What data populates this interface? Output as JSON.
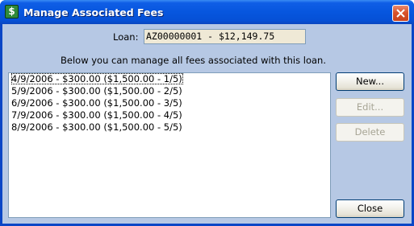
{
  "window": {
    "title": "Manage Associated Fees",
    "icon": "dollar-note-icon",
    "close_icon": "close-icon"
  },
  "loan": {
    "label": "Loan:",
    "value": "AZ00000001 - $12,149.75"
  },
  "instruction": "Below you can manage all fees associated with this loan.",
  "fees": [
    "4/9/2006 - $300.00 ($1,500.00 - 1/5)",
    "5/9/2006 - $300.00 ($1,500.00 - 2/5)",
    "6/9/2006 - $300.00 ($1,500.00 - 3/5)",
    "7/9/2006 - $300.00 ($1,500.00 - 4/5)",
    "8/9/2006 - $300.00 ($1,500.00 - 5/5)"
  ],
  "buttons": {
    "new": "New...",
    "edit": "Edit...",
    "delete": "Delete",
    "close": "Close"
  },
  "colors": {
    "titlebar": "#0756de",
    "client": "#b6c8e4",
    "close_button": "#d9532c",
    "readonly_field": "#efe9d6"
  }
}
